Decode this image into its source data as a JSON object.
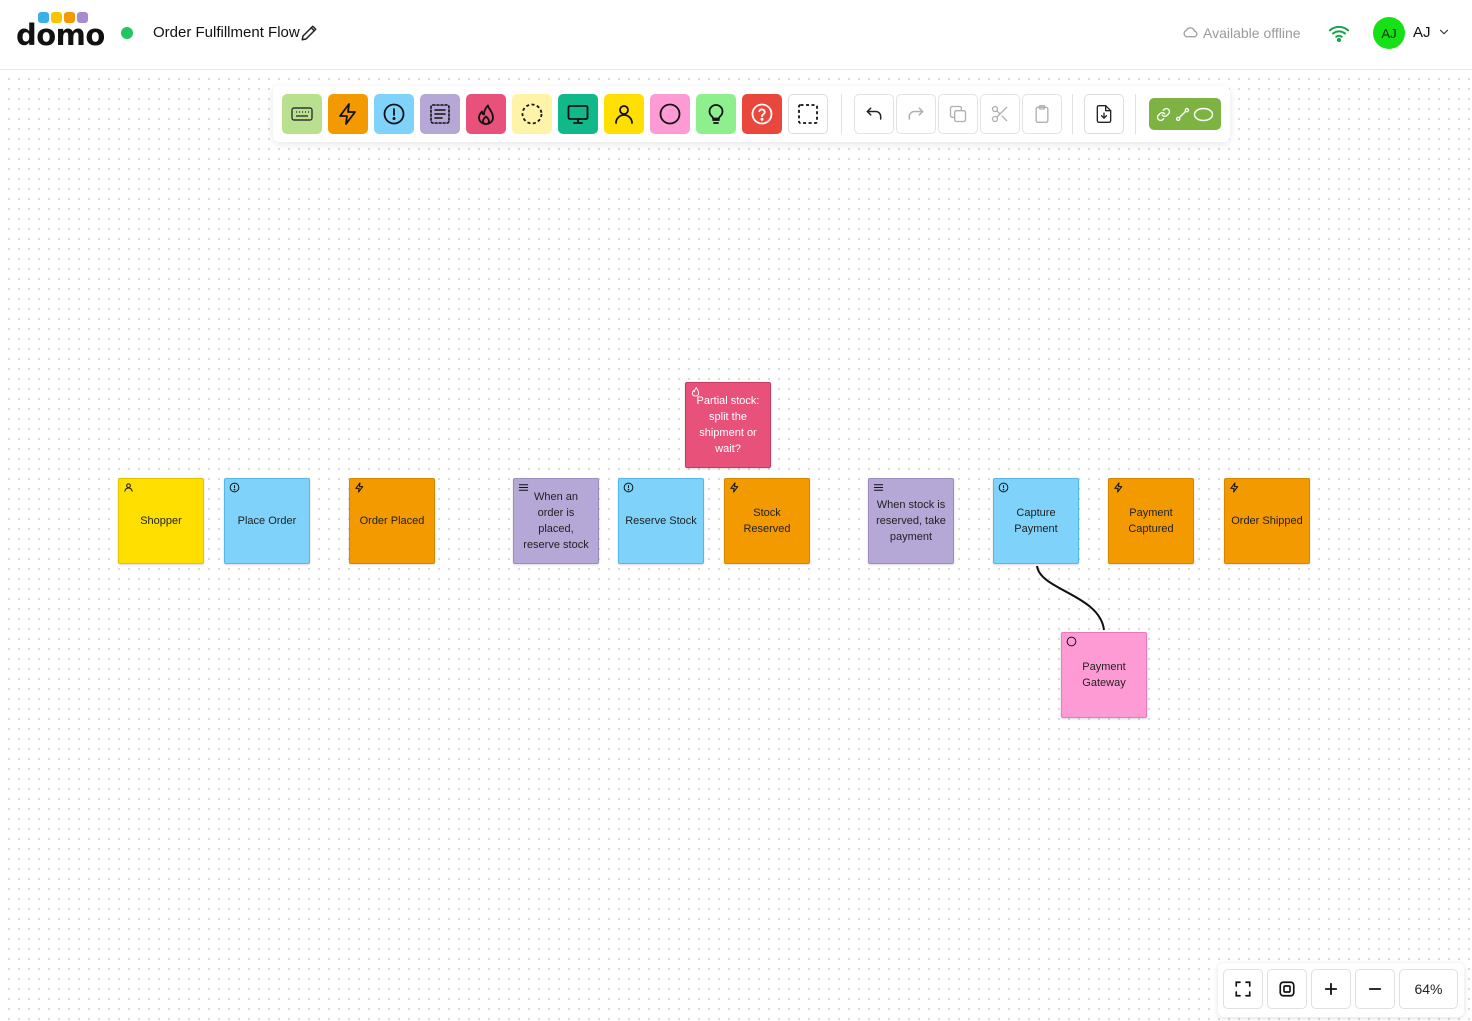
{
  "app": {
    "logo_text": "domo",
    "logo_dot_colors": [
      "#3bb0e8",
      "#f7c600",
      "#f29a00",
      "#a98ad0"
    ],
    "status_color": "#22c55e"
  },
  "header": {
    "board_title": "Order Fulfillment Flow",
    "offline_label": "Available offline",
    "user_initials": "AJ",
    "user_name": "AJ",
    "avatar_color": "#16e016"
  },
  "toolbar": {
    "sticky_tools": [
      {
        "name": "comment-tool",
        "icon": "keyboard-icon",
        "color": "#b9e08f"
      },
      {
        "name": "event-tool",
        "icon": "lightning-icon",
        "color": "#f29a00"
      },
      {
        "name": "command-tool",
        "icon": "exclamation-icon",
        "color": "#7fd3fb"
      },
      {
        "name": "policy-tool",
        "icon": "list-icon",
        "color": "#b5a7d6"
      },
      {
        "name": "hotspot-tool",
        "icon": "flame-icon",
        "color": "#e8517a"
      },
      {
        "name": "aggregate-tool",
        "icon": "dashed-circle-icon",
        "color": "#fff3a8"
      },
      {
        "name": "read-model-tool",
        "icon": "monitor-icon",
        "color": "#11b88a"
      },
      {
        "name": "actor-tool",
        "icon": "person-icon",
        "color": "#ffdf00"
      },
      {
        "name": "external-system-tool",
        "icon": "circle-icon",
        "color": "#ff9bd4"
      },
      {
        "name": "opportunity-tool",
        "icon": "lightbulb-icon",
        "color": "#8df08d"
      },
      {
        "name": "question-tool",
        "icon": "question-icon",
        "color": "#e9473b"
      },
      {
        "name": "boundary-tool",
        "icon": "dashed-square-icon",
        "color": "#ffffff"
      }
    ],
    "actions": [
      "undo-icon",
      "redo-icon",
      "copy-icon",
      "cut-icon",
      "paste-icon"
    ],
    "export": "export-icon",
    "link_group_color": "#7cb342"
  },
  "stickies": [
    {
      "id": "shopper",
      "text": "Shopper",
      "kind": "actor",
      "icon": "person-icon",
      "color": "yellow"
    },
    {
      "id": "place-order",
      "text": "Place Order",
      "kind": "command",
      "icon": "exclamation-icon",
      "color": "blue"
    },
    {
      "id": "order-placed",
      "text": "Order Placed",
      "kind": "event",
      "icon": "lightning-icon",
      "color": "orange"
    },
    {
      "id": "policy-reserve",
      "text": "When an order is placed, reserve stock",
      "kind": "policy",
      "icon": "list-icon",
      "color": "purple"
    },
    {
      "id": "reserve-stock",
      "text": "Reserve Stock",
      "kind": "command",
      "icon": "exclamation-icon",
      "color": "blue"
    },
    {
      "id": "stock-reserved",
      "text": "Stock Reserved",
      "kind": "event",
      "icon": "lightning-icon",
      "color": "orange"
    },
    {
      "id": "hotspot-partial",
      "text": "Partial stock: split the shipment or wait?",
      "kind": "hotspot",
      "icon": "flame-icon",
      "color": "red"
    },
    {
      "id": "policy-payment",
      "text": "When stock is reserved, take payment",
      "kind": "policy",
      "icon": "list-icon",
      "color": "purple"
    },
    {
      "id": "capture-payment",
      "text": "Capture Payment",
      "kind": "command",
      "icon": "exclamation-icon",
      "color": "blue"
    },
    {
      "id": "payment-captured",
      "text": "Payment Captured",
      "kind": "event",
      "icon": "lightning-icon",
      "color": "orange"
    },
    {
      "id": "order-shipped",
      "text": "Order Shipped",
      "kind": "event",
      "icon": "lightning-icon",
      "color": "orange"
    },
    {
      "id": "payment-gateway",
      "text": "Payment Gateway",
      "kind": "external-system",
      "icon": "circle-icon",
      "color": "pink"
    }
  ],
  "connections": [
    {
      "from": "capture-payment",
      "to": "payment-gateway"
    }
  ],
  "zoom": {
    "level": "64%"
  }
}
